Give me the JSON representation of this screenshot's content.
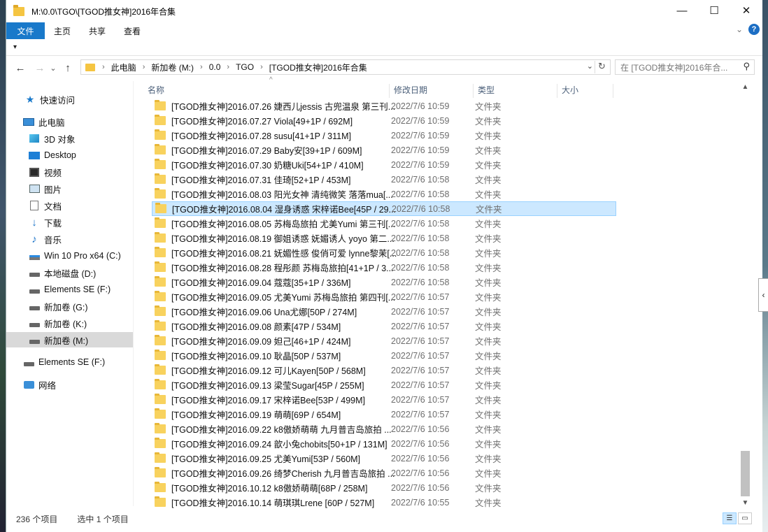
{
  "window": {
    "title": "M:\\0.0\\TGO\\[TGOD推女神]2016年合集",
    "minimize": "—",
    "maximize": "☐",
    "close": "✕"
  },
  "ribbon": {
    "tabs": [
      "文件",
      "主页",
      "共享",
      "查看"
    ],
    "help": "?",
    "expand": "⌄",
    "qat": "▾"
  },
  "address": {
    "back": "←",
    "forward": "→",
    "recent": "⌄",
    "up": "↑",
    "crumbs": [
      "此电脑",
      "新加卷 (M:)",
      "0.0",
      "TGO",
      "[TGOD推女神]2016年合集"
    ],
    "search_placeholder": "在 [TGOD推女神]2016年合..."
  },
  "navpane": {
    "items": [
      {
        "label": "快速访问",
        "icon": "star-icon"
      },
      {
        "label": "此电脑",
        "icon": "computer-icon"
      },
      {
        "label": "3D 对象",
        "icon": "3d-objects-icon"
      },
      {
        "label": "Desktop",
        "icon": "desktop-icon"
      },
      {
        "label": "视频",
        "icon": "video-icon"
      },
      {
        "label": "图片",
        "icon": "pictures-icon"
      },
      {
        "label": "文档",
        "icon": "documents-icon"
      },
      {
        "label": "下载",
        "icon": "download-icon"
      },
      {
        "label": "音乐",
        "icon": "music-icon"
      },
      {
        "label": "Win 10 Pro x64 (C:)",
        "icon": "system-drive-icon"
      },
      {
        "label": "本地磁盘 (D:)",
        "icon": "drive-icon"
      },
      {
        "label": "Elements SE (F:)",
        "icon": "drive-icon"
      },
      {
        "label": "新加卷 (G:)",
        "icon": "drive-icon"
      },
      {
        "label": "新加卷 (K:)",
        "icon": "drive-icon"
      },
      {
        "label": "新加卷 (M:)",
        "icon": "drive-icon"
      },
      {
        "label": "Elements SE (F:)",
        "icon": "drive-icon"
      },
      {
        "label": "网络",
        "icon": "network-icon"
      }
    ]
  },
  "columns": {
    "name": "名称",
    "date": "修改日期",
    "type": "类型",
    "size": "大小"
  },
  "files": [
    {
      "name": "[TGOD推女神]2016.07.26 婕西儿jessis 古兜温泉 第三刊...",
      "date": "2022/7/6 10:59",
      "type": "文件夹"
    },
    {
      "name": "[TGOD推女神]2016.07.27 Viola[49+1P / 692M]",
      "date": "2022/7/6 10:59",
      "type": "文件夹"
    },
    {
      "name": "[TGOD推女神]2016.07.28 susu[41+1P / 311M]",
      "date": "2022/7/6 10:59",
      "type": "文件夹"
    },
    {
      "name": "[TGOD推女神]2016.07.29 Baby安[39+1P / 609M]",
      "date": "2022/7/6 10:59",
      "type": "文件夹"
    },
    {
      "name": "[TGOD推女神]2016.07.30 奶糖Uki[54+1P / 410M]",
      "date": "2022/7/6 10:59",
      "type": "文件夹"
    },
    {
      "name": "[TGOD推女神]2016.07.31 佳琦[52+1P / 453M]",
      "date": "2022/7/6 10:58",
      "type": "文件夹"
    },
    {
      "name": "[TGOD推女神]2016.08.03 阳光女神 清纯微笑 落落mua[...",
      "date": "2022/7/6 10:58",
      "type": "文件夹"
    },
    {
      "name": "[TGOD推女神]2016.08.04 湿身诱惑 宋梓诺Bee[45P / 29...",
      "date": "2022/7/6 10:58",
      "type": "文件夹"
    },
    {
      "name": "[TGOD推女神]2016.08.05 苏梅岛旅拍 尤美Yumi 第三刊[...",
      "date": "2022/7/6 10:58",
      "type": "文件夹"
    },
    {
      "name": "[TGOD推女神]2016.08.19 御姐诱惑 妩媚诱人 yoyo 第二...",
      "date": "2022/7/6 10:58",
      "type": "文件夹"
    },
    {
      "name": "[TGOD推女神]2016.08.21 妩媚性感 俊俏可爱 lynne黎茉[...",
      "date": "2022/7/6 10:58",
      "type": "文件夹"
    },
    {
      "name": "[TGOD推女神]2016.08.28 程彤颜 苏梅岛旅拍[41+1P / 3...",
      "date": "2022/7/6 10:58",
      "type": "文件夹"
    },
    {
      "name": "[TGOD推女神]2016.09.04 蔻蔻[35+1P / 336M]",
      "date": "2022/7/6 10:58",
      "type": "文件夹"
    },
    {
      "name": "[TGOD推女神]2016.09.05 尤美Yumi 苏梅岛旅拍 第四刊[...",
      "date": "2022/7/6 10:57",
      "type": "文件夹"
    },
    {
      "name": "[TGOD推女神]2016.09.06 Una尤娜[50P / 274M]",
      "date": "2022/7/6 10:57",
      "type": "文件夹"
    },
    {
      "name": "[TGOD推女神]2016.09.08 颜素[47P / 534M]",
      "date": "2022/7/6 10:57",
      "type": "文件夹"
    },
    {
      "name": "[TGOD推女神]2016.09.09 妲己[46+1P / 424M]",
      "date": "2022/7/6 10:57",
      "type": "文件夹"
    },
    {
      "name": "[TGOD推女神]2016.09.10 耿晶[50P / 537M]",
      "date": "2022/7/6 10:57",
      "type": "文件夹"
    },
    {
      "name": "[TGOD推女神]2016.09.12 可儿Kayen[50P / 568M]",
      "date": "2022/7/6 10:57",
      "type": "文件夹"
    },
    {
      "name": "[TGOD推女神]2016.09.13 梁莹Sugar[45P / 255M]",
      "date": "2022/7/6 10:57",
      "type": "文件夹"
    },
    {
      "name": "[TGOD推女神]2016.09.17 宋梓诺Bee[53P / 499M]",
      "date": "2022/7/6 10:57",
      "type": "文件夹"
    },
    {
      "name": "[TGOD推女神]2016.09.19 萌萌[69P / 654M]",
      "date": "2022/7/6 10:57",
      "type": "文件夹"
    },
    {
      "name": "[TGOD推女神]2016.09.22 k8傲娇萌萌 九月普吉岛旅拍 ...",
      "date": "2022/7/6 10:56",
      "type": "文件夹"
    },
    {
      "name": "[TGOD推女神]2016.09.24 歆小兔chobits[50+1P / 131M]",
      "date": "2022/7/6 10:56",
      "type": "文件夹"
    },
    {
      "name": "[TGOD推女神]2016.09.25 尤美Yumi[53P / 560M]",
      "date": "2022/7/6 10:56",
      "type": "文件夹"
    },
    {
      "name": "[TGOD推女神]2016.09.26 绮梦Cherish 九月普吉岛旅拍 ...",
      "date": "2022/7/6 10:56",
      "type": "文件夹"
    },
    {
      "name": "[TGOD推女神]2016.10.12 k8傲娇萌萌[68P / 258M]",
      "date": "2022/7/6 10:56",
      "type": "文件夹"
    },
    {
      "name": "[TGOD推女神]2016.10.14 萌琪琪Lrene [60P / 527M]",
      "date": "2022/7/6 10:55",
      "type": "文件夹"
    }
  ],
  "selected_index": 7,
  "status": {
    "count": "236 个项目",
    "selection": "选中 1 个项目"
  }
}
